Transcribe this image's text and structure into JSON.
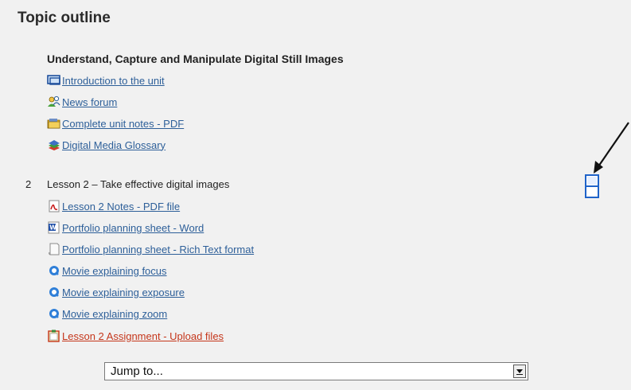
{
  "page_title": "Topic outline",
  "section0": {
    "title": "Understand, Capture and Manipulate Digital Still Images",
    "items": [
      {
        "label": "Introduction to the unit",
        "icon": "monitor-icon"
      },
      {
        "label": "News forum",
        "icon": "forum-people-icon"
      },
      {
        "label": "Complete unit notes - PDF",
        "icon": "folder-icon"
      },
      {
        "label": "Digital Media Glossary",
        "icon": "books-icon"
      }
    ]
  },
  "section2": {
    "number": "2",
    "title": "Lesson 2 – Take effective digital images",
    "items": [
      {
        "label": "Lesson 2 Notes - PDF file",
        "icon": "pdf-icon"
      },
      {
        "label": "Portfolio planning sheet - Word",
        "icon": "word-icon"
      },
      {
        "label": "Portfolio planning sheet - Rich Text format",
        "icon": "rtf-document-icon"
      },
      {
        "label": "Movie explaining focus",
        "icon": "quicktime-icon"
      },
      {
        "label": "Movie explaining exposure",
        "icon": "quicktime-icon"
      },
      {
        "label": "Movie explaining zoom",
        "icon": "quicktime-icon"
      },
      {
        "label": "Lesson 2 Assignment - Upload files",
        "icon": "assignment-clipboard-icon"
      }
    ]
  },
  "jump": {
    "label": "Jump to..."
  },
  "colors": {
    "link": "#2d5f99",
    "assignment": "#c5361b",
    "toggle": "#1f63c9"
  }
}
